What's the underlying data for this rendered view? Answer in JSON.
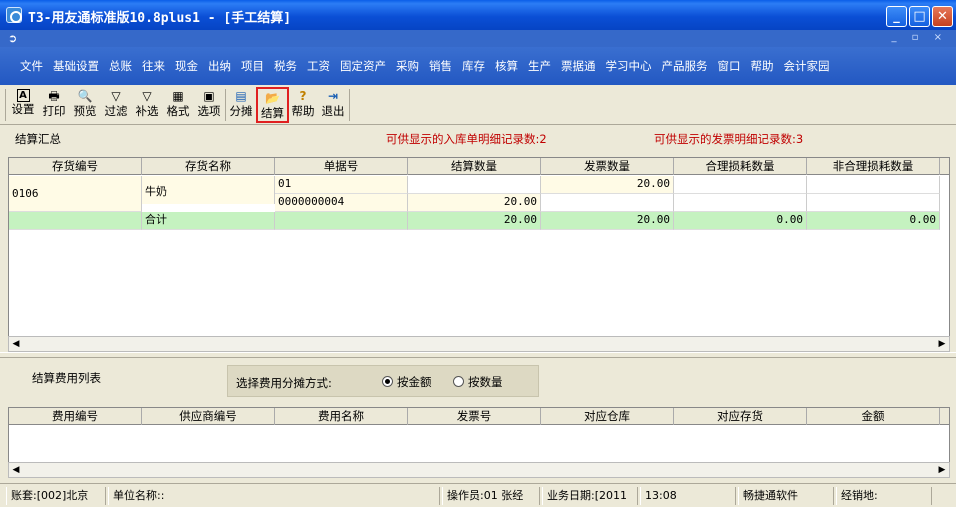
{
  "window": {
    "title": "T3-用友通标准版10.8plus1 - [手工结算]",
    "btn_min": "_",
    "btn_max": "□",
    "btn_close": "✕"
  },
  "menu": [
    "文件",
    "基础设置",
    "总账",
    "往来",
    "现金",
    "出纳",
    "项目",
    "税务",
    "工资",
    "固定资产",
    "采购",
    "销售",
    "库存",
    "核算",
    "生产",
    "票据通",
    "学习中心",
    "产品服务",
    "窗口",
    "帮助",
    "会计家园"
  ],
  "toolbar": {
    "items": [
      {
        "label": "设置",
        "icon": "A"
      },
      {
        "label": "打印",
        "icon": "🖶"
      },
      {
        "label": "预览",
        "icon": "🔍"
      },
      {
        "label": "过滤",
        "icon": "▽"
      },
      {
        "label": "补选",
        "icon": "▽"
      },
      {
        "label": "格式",
        "icon": "▦"
      },
      {
        "label": "选项",
        "icon": "▣"
      },
      {
        "label": "分摊",
        "icon": "▤"
      },
      {
        "label": "结算",
        "icon": "📂"
      },
      {
        "label": "帮助",
        "icon": "?"
      },
      {
        "label": "退出",
        "icon": "⇥"
      }
    ]
  },
  "summary": {
    "title": "结算汇总",
    "notice_receipt": "可供显示的入库单明细记录数:2",
    "notice_invoice": "可供显示的发票明细记录数:3",
    "columns": [
      "存货编号",
      "存货名称",
      "单据号",
      "结算数量",
      "发票数量",
      "合理损耗数量",
      "非合理损耗数量"
    ],
    "item_code": "0106",
    "item_name": "牛奶",
    "rows": [
      {
        "doc_no": "01",
        "settle_qty": "",
        "invoice_qty": "20.00",
        "loss_ok": "",
        "loss_bad": ""
      },
      {
        "doc_no": "0000000004",
        "settle_qty": "20.00",
        "invoice_qty": "",
        "loss_ok": "",
        "loss_bad": ""
      }
    ],
    "total": {
      "label": "合计",
      "settle_qty": "20.00",
      "invoice_qty": "20.00",
      "loss_ok": "0.00",
      "loss_bad": "0.00"
    }
  },
  "fees": {
    "title": "结算费用列表",
    "alloc_label": "选择费用分摊方式:",
    "opt_amount": "按金额",
    "opt_qty": "按数量",
    "selected": "amount",
    "columns": [
      "费用编号",
      "供应商编号",
      "费用名称",
      "发票号",
      "对应仓库",
      "对应存货",
      "金额"
    ]
  },
  "status": {
    "account": "账套:[002]北京",
    "unit": "单位名称::",
    "operator": "操作员:01 张经",
    "bizdate": "业务日期:[2011",
    "time": "13:08",
    "vendor": "畅捷通软件",
    "site": "经销地:"
  }
}
